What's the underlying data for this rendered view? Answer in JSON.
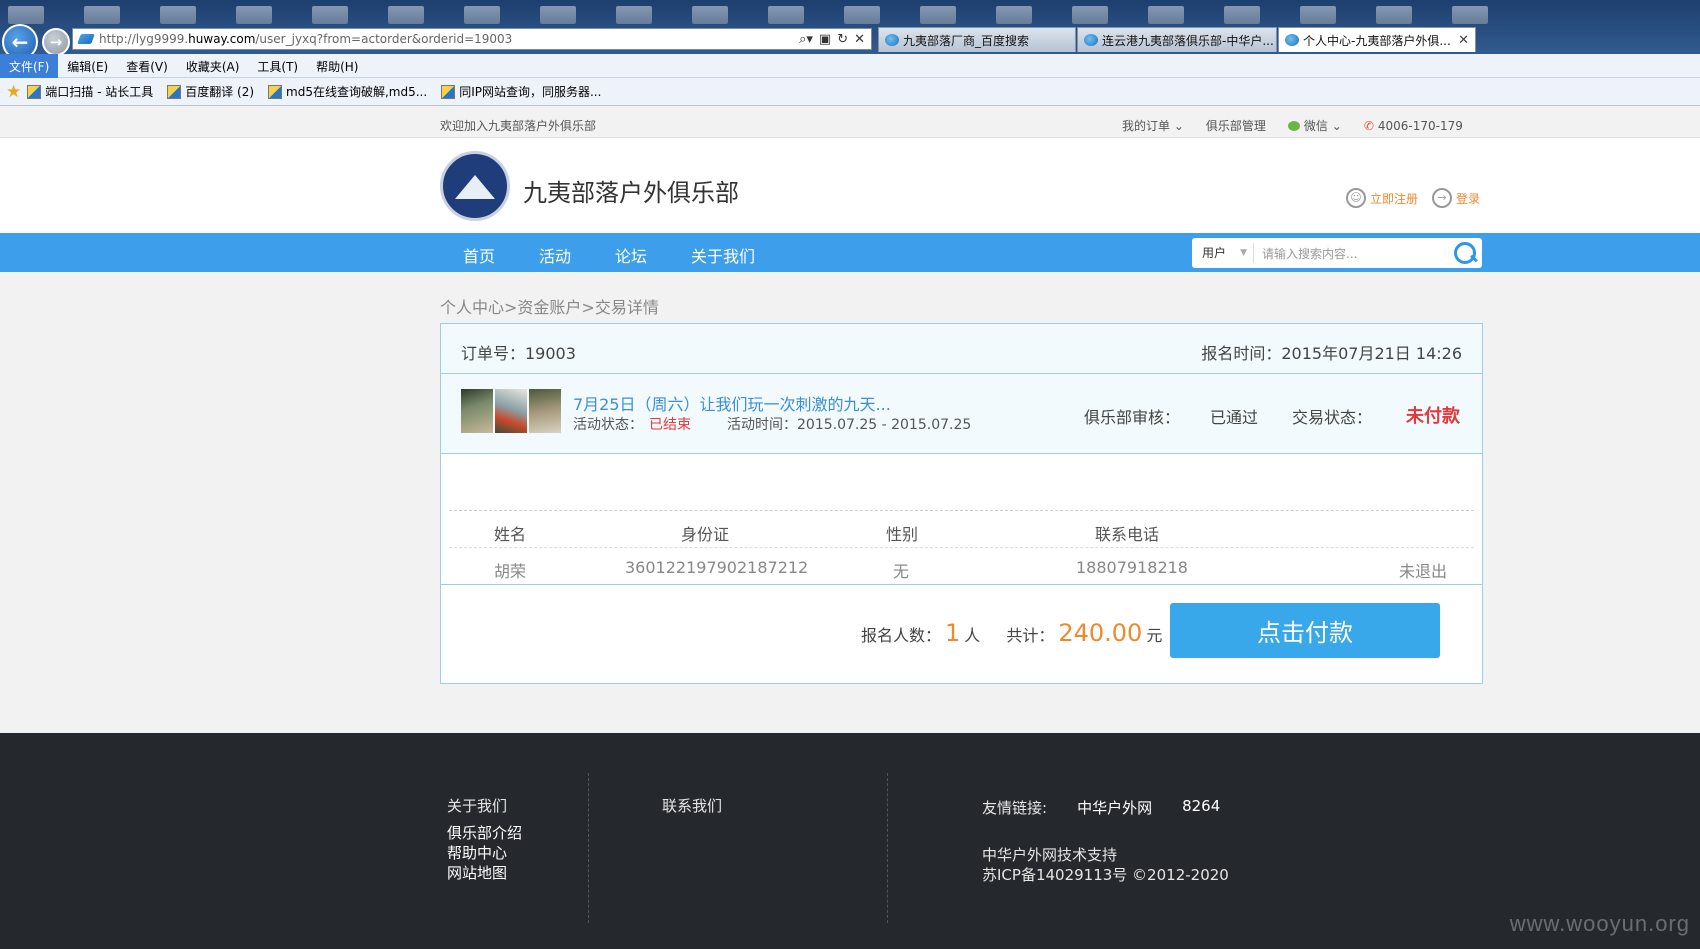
{
  "browser": {
    "url_prefix": "http://lyg9999.",
    "url_host": "huway.com",
    "url_path": "/user_jyxq?from=actorder&orderid=19003",
    "tabs": [
      {
        "label": "九夷部落厂商_百度搜索"
      },
      {
        "label": "连云港九夷部落俱乐部-中华户..."
      },
      {
        "label": "个人中心-九夷部落户外俱...",
        "close": "✕"
      }
    ],
    "menu": [
      "文件(F)",
      "编辑(E)",
      "查看(V)",
      "收藏夹(A)",
      "工具(T)",
      "帮助(H)"
    ],
    "favorites": [
      "端口扫描 - 站长工具",
      "百度翻译 (2)",
      "md5在线查询破解,md5...",
      "同IP网站查询，同服务器..."
    ]
  },
  "topbar": {
    "welcome": "欢迎加入九夷部落户外俱乐部",
    "my_orders": "我的订单",
    "club_manage": "俱乐部管理",
    "wechat": "微信",
    "phone": "4006-170-179"
  },
  "header": {
    "site_name": "九夷部落户外俱乐部",
    "register": "立即注册",
    "login": "登录"
  },
  "nav": {
    "items": [
      "首页",
      "活动",
      "论坛",
      "关于我们"
    ],
    "search_scope": "用户",
    "search_placeholder": "请输入搜索内容..."
  },
  "breadcrumb": "个人中心>资金账户>交易详情",
  "order": {
    "order_no_label": "订单号：19003",
    "signup_time": "报名时间：2015年07月21日 14:26",
    "activity_title": "7月25日（周六）让我们玩一次刺激的九天...",
    "activity_status_label": "活动状态：",
    "activity_status": "已结束",
    "activity_time": "活动时间：2015.07.25 - 2015.07.25",
    "club_review_label": "俱乐部审核：",
    "club_review": "已通过",
    "trade_status_label": "交易状态：",
    "trade_status": "未付款",
    "table_headers": [
      "姓名",
      "身份证",
      "性别",
      "联系电话"
    ],
    "participant": {
      "name": "胡荣",
      "id_card": "360122197902187212",
      "gender": "无",
      "phone": "18807918218",
      "status": "未退出"
    },
    "count_label": "报名人数：",
    "count": "1",
    "count_unit": "人",
    "total_label": "共计：",
    "total": "240.00",
    "total_unit": "元",
    "pay_button": "点击付款"
  },
  "footer": {
    "about_title": "关于我们",
    "about_links": [
      "俱乐部介绍",
      "帮助中心",
      "网站地图"
    ],
    "contact_title": "联系我们",
    "friend_label": "友情链接:",
    "friend_links": [
      "中华户外网",
      "8264"
    ],
    "support": "中华户外网技术支持",
    "icp": "苏ICP备14029113号 ©2012-2020"
  },
  "watermark": "www.wooyun.org"
}
